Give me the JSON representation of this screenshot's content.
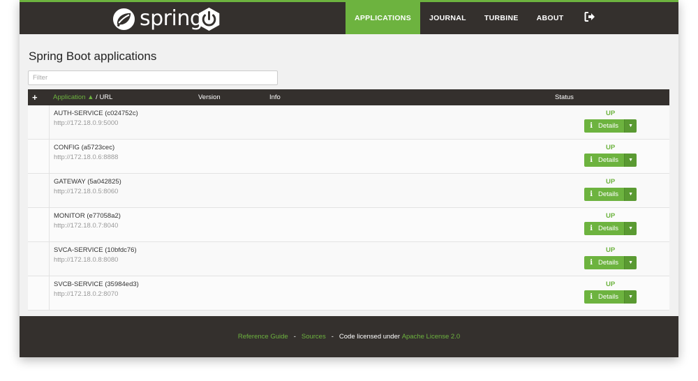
{
  "header": {
    "brand": "spring",
    "nav": [
      "APPLICATIONS",
      "JOURNAL",
      "TURBINE",
      "ABOUT"
    ],
    "active": "APPLICATIONS",
    "icons": [
      "spring-leaf-icon",
      "power-icon",
      "logout-icon"
    ]
  },
  "page": {
    "title": "Spring Boot applications",
    "filter_placeholder": "Filter"
  },
  "table": {
    "add": "+",
    "col_application": "Application ▲",
    "col_url": " / URL",
    "col_version": "Version",
    "col_info": "Info",
    "col_status": "Status",
    "details_label": "Details",
    "rows": [
      {
        "name": "AUTH-SERVICE (c024752c)",
        "url": "http://172.18.0.9:5000",
        "status": "UP"
      },
      {
        "name": "CONFIG (a5723cec)",
        "url": "http://172.18.0.6:8888",
        "status": "UP"
      },
      {
        "name": "GATEWAY (5a042825)",
        "url": "http://172.18.0.5:8060",
        "status": "UP"
      },
      {
        "name": "MONITOR (e77058a2)",
        "url": "http://172.18.0.7:8040",
        "status": "UP"
      },
      {
        "name": "SVCA-SERVICE (10bfdc76)",
        "url": "http://172.18.0.8:8080",
        "status": "UP"
      },
      {
        "name": "SVCB-SERVICE (35984ed3)",
        "url": "http://172.18.0.2:8070",
        "status": "UP"
      }
    ]
  },
  "footer": {
    "reference_guide": "Reference Guide",
    "sep": "-",
    "sources": "Sources",
    "licensed": "Code licensed under",
    "license": "Apache License 2.0"
  },
  "colors": {
    "brand_green": "#6db33f",
    "dark": "#34302d"
  }
}
